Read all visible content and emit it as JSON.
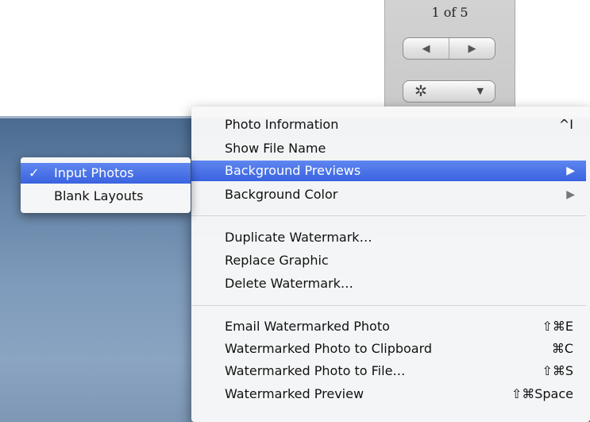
{
  "toolbar": {
    "counter": "1 of 5",
    "prev_icon": "left-triangle-icon",
    "next_icon": "right-triangle-icon",
    "gear_icon": "gear-icon",
    "caret_icon": "chevron-down-icon"
  },
  "submenu": {
    "items": [
      {
        "label": "Input Photos",
        "checked": true,
        "check": "✓"
      },
      {
        "label": "Blank Layouts",
        "checked": false,
        "check": ""
      }
    ]
  },
  "menu": {
    "items": [
      {
        "label": "Photo Information",
        "shortcut": "^I"
      },
      {
        "label": "Show File Name",
        "shortcut": ""
      },
      {
        "label": "Background Previews",
        "shortcut": "",
        "submenu": true,
        "highlighted": true
      },
      {
        "label": "Background Color",
        "shortcut": "",
        "submenu": true
      },
      {
        "label": "Duplicate Watermark…",
        "shortcut": ""
      },
      {
        "label": "Replace Graphic",
        "shortcut": ""
      },
      {
        "label": "Delete Watermark…",
        "shortcut": ""
      },
      {
        "label": "Email Watermarked Photo",
        "shortcut": "⇧⌘E"
      },
      {
        "label": "Watermarked Photo to Clipboard",
        "shortcut": "⌘C"
      },
      {
        "label": "Watermarked Photo to File…",
        "shortcut": "⇧⌘S"
      },
      {
        "label": "Watermarked Preview",
        "shortcut": "⇧⌘Space"
      }
    ]
  },
  "colors": {
    "highlight": "#3a63e0",
    "menu_bg": "#f8f8f8",
    "sky": "#7f9bbb"
  }
}
